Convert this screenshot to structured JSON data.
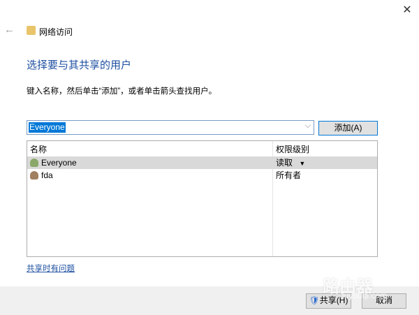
{
  "window": {
    "close_icon": "close-icon",
    "back_icon": "back-arrow-icon",
    "title": "网络访问"
  },
  "heading": "选择要与其共享的用户",
  "instruction": "键入名称，然后单击“添加”，或者单击箭头查找用户。",
  "combo": {
    "value": "Everyone",
    "chevron": "⌵"
  },
  "add_button": "添加(A)",
  "list": {
    "columns": [
      "名称",
      "权限级别"
    ],
    "rows": [
      {
        "name": "Everyone",
        "permission": "读取",
        "dropdown": "▼",
        "selected": true
      },
      {
        "name": "fda",
        "permission": "所有者",
        "selected": false
      }
    ]
  },
  "help_link": "共享时有问题",
  "footer": {
    "share": "共享(H)",
    "cancel": "取消"
  },
  "watermark": {
    "text": "路由器",
    "url_text": "luyouqi.com"
  }
}
